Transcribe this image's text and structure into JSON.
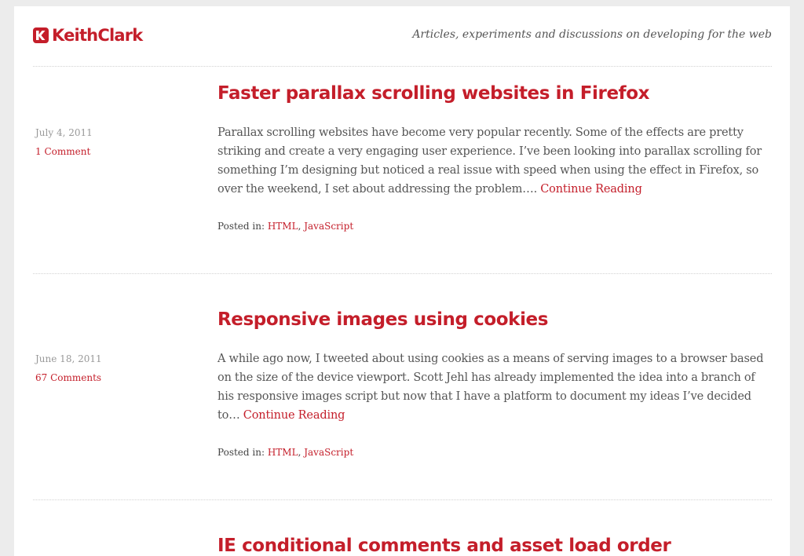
{
  "site": {
    "logo_text": "KeithClark",
    "tagline": "Articles, experiments and discussions on developing for the web",
    "brand_color": "#c41e2a",
    "logo_icon": "kc-logo-icon"
  },
  "posts": [
    {
      "title": "Faster parallax scrolling websites in Firefox",
      "date": "July 4, 2011",
      "comments": "1 Comment",
      "excerpt": "Parallax scrolling websites have become very popular recently. Some of the effects are pretty striking and create a very engaging user experience. I’ve been looking into parallax scrolling for something I’m designing but noticed a real issue with speed when using the effect in Firefox, so over the weekend, I set about addressing the problem….",
      "continue": "Continue Reading",
      "posted_in_label": "Posted in:",
      "tags": [
        "HTML",
        "JavaScript"
      ],
      "tag_separator": ","
    },
    {
      "title": "Responsive images using cookies",
      "date": "June 18, 2011",
      "comments": "67 Comments",
      "excerpt": "A while ago now, I tweeted about using cookies as a means of serving images to a browser based on the size of the device viewport. Scott Jehl has already implemented the idea into a branch of his responsive images script but now that I have a platform to document my ideas I’ve decided to…",
      "continue": "Continue Reading",
      "posted_in_label": "Posted in:",
      "tags": [
        "HTML",
        "JavaScript"
      ],
      "tag_separator": ","
    },
    {
      "title": "IE conditional comments and asset load order"
    }
  ]
}
